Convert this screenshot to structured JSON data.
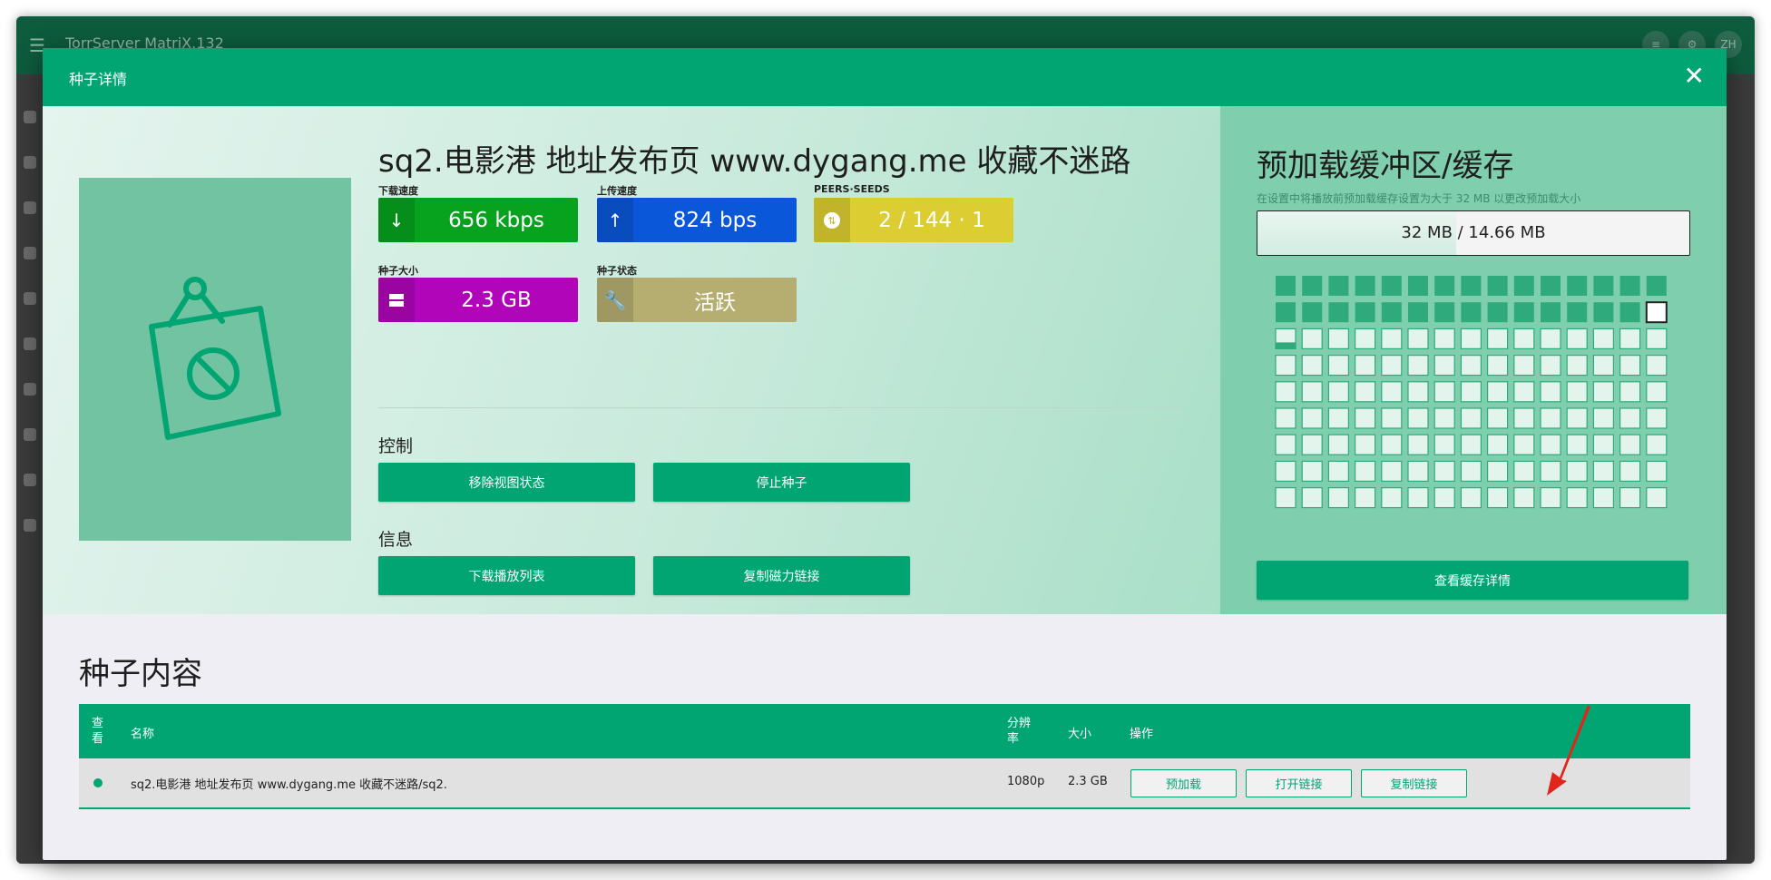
{
  "app": {
    "title": "TorrServer MatriX.132",
    "avatar": "ZH"
  },
  "dialog": {
    "title": "种子详情",
    "close_icon": "close-icon"
  },
  "torrent": {
    "name": "sq2.电影港 地址发布页 www.dygang.me 收藏不迷路",
    "stats": {
      "download": {
        "label": "下载速度",
        "value": "656 kbps",
        "color": "#07a21e"
      },
      "upload": {
        "label": "上传速度",
        "value": "824 bps",
        "color": "#0b57d9"
      },
      "peers": {
        "label": "PEERS·SEEDS",
        "value": "2 / 144 · 1",
        "color": "#dccd32"
      },
      "size": {
        "label": "种子大小",
        "value": "2.3 GB",
        "color": "#b005b8"
      },
      "state": {
        "label": "种子状态",
        "value": "活跃",
        "color": "#b6ad70"
      }
    }
  },
  "controls": {
    "title": "控制",
    "remove_view": "移除视图状态",
    "stop": "停止种子"
  },
  "info": {
    "title": "信息",
    "download_playlist": "下载播放列表",
    "copy_magnet": "复制磁力链接"
  },
  "cache": {
    "title": "预加载缓冲区/缓存",
    "hint": "在设置中将播放前预加载缓存设置为大于 32 MB 以更改预加载大小",
    "progress_text": "32 MB / 14.66 MB",
    "progress_fraction": 0.46,
    "pieces": {
      "total": 135,
      "filled": 29,
      "active_index": 29,
      "current_index": 30
    },
    "details_button": "查看缓存详情"
  },
  "content": {
    "title": "种子内容",
    "columns": {
      "view": "查看",
      "name": "名称",
      "resolution": "分辨率",
      "size": "大小",
      "actions": "操作"
    },
    "rows": [
      {
        "name": "sq2.电影港 地址发布页 www.dygang.me 收藏不迷路/sq2.",
        "resolution": "1080p",
        "size": "2.3 GB",
        "preload": "预加载",
        "open_link": "打开链接",
        "copy_link": "复制链接"
      }
    ]
  }
}
